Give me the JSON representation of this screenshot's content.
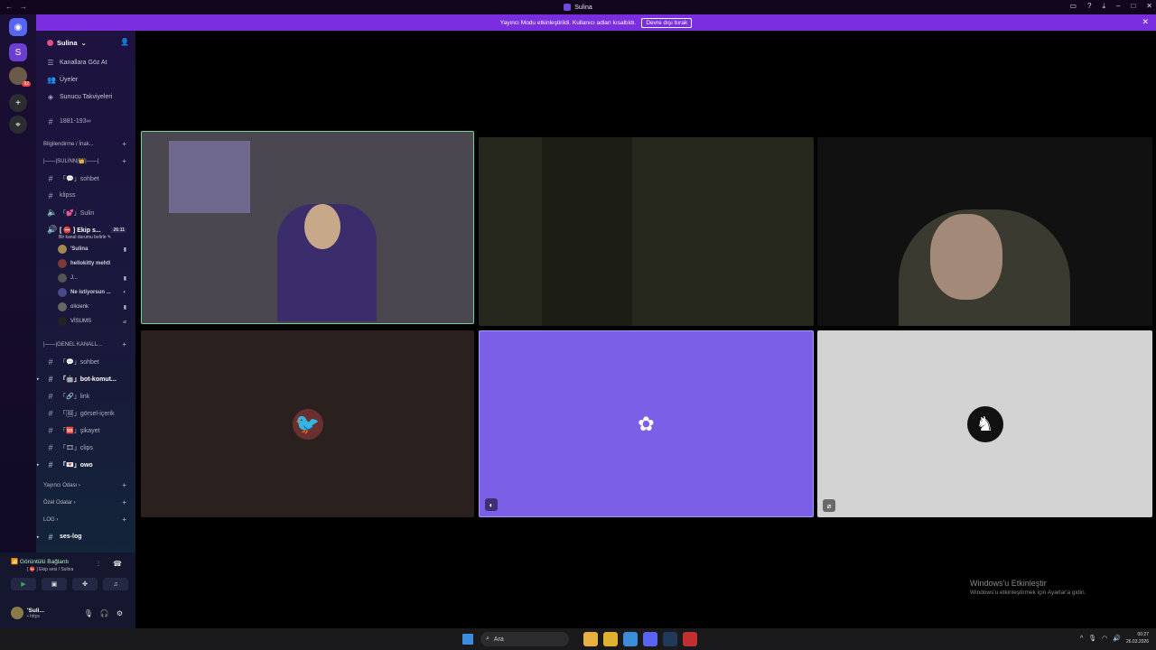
{
  "window": {
    "title": "Sulina"
  },
  "banner": {
    "text": "Yayıncı Modu etkinleştirildi. Kullanıcı adları kısaltıldı.",
    "button": "Devre dışı bırak"
  },
  "rail": {
    "badge": "92"
  },
  "server": {
    "name": "Sulina"
  },
  "nav": [
    {
      "label": "Kanallara Göz At"
    },
    {
      "label": "Üyeler"
    },
    {
      "label": "Sunucu Takviyeleri"
    }
  ],
  "channel_top": "1881-193∞",
  "categories": {
    "info": "Bilgilendirme / İnak...",
    "sulinn": "|——|SULİNN|👑|——|",
    "genel": "|——|GENEL KANALL...",
    "yayinci": "Yayıncı Odası",
    "ozel": "Özel Odalar",
    "log": "LOG"
  },
  "channels_a": [
    {
      "label": "「💬」sohbet"
    },
    {
      "label": "klipss"
    },
    {
      "label": "「💕」Sulin"
    }
  ],
  "voice_channel": {
    "label": "[ ⛔ ] Ekip s...",
    "timer": "26:11",
    "sub": "Bir kanal durumu belirle ✎"
  },
  "voice_users": [
    {
      "name": "'Sulina"
    },
    {
      "name": "hellokitty mehtl"
    },
    {
      "name": "J..."
    },
    {
      "name": "Ne istiyorsun ..."
    },
    {
      "name": "olicienk"
    },
    {
      "name": "VİSUMS"
    }
  ],
  "channels_b": [
    {
      "label": "「💬」sohbet"
    },
    {
      "label": "「🤖」bot-komut..."
    },
    {
      "label": "「🔗」link"
    },
    {
      "label": "「🖼」görsel-içerik"
    },
    {
      "label": "「🆘」şikayet"
    },
    {
      "label": "「🎞」clips"
    },
    {
      "label": "「💌」owo"
    }
  ],
  "log_channel": "ses-log",
  "voice_panel": {
    "status": "Görüntülü Bağlantı",
    "sub": "[ ⛔ ] Ekip sesi / Sulina"
  },
  "user": {
    "name": "'Suli...",
    "status": "• https"
  },
  "watermark": {
    "title": "Windows'u Etkinleştir",
    "sub": "Windows'u etkinleştirmek için Ayarlar'a gidin."
  },
  "taskbar": {
    "search": "Ara",
    "time": "00:27",
    "date": "26.03.2026"
  },
  "colors": {
    "accent": "#7a2ee0",
    "speaking": "#6fd3a0",
    "tile_purple": "#7b5fe6"
  }
}
